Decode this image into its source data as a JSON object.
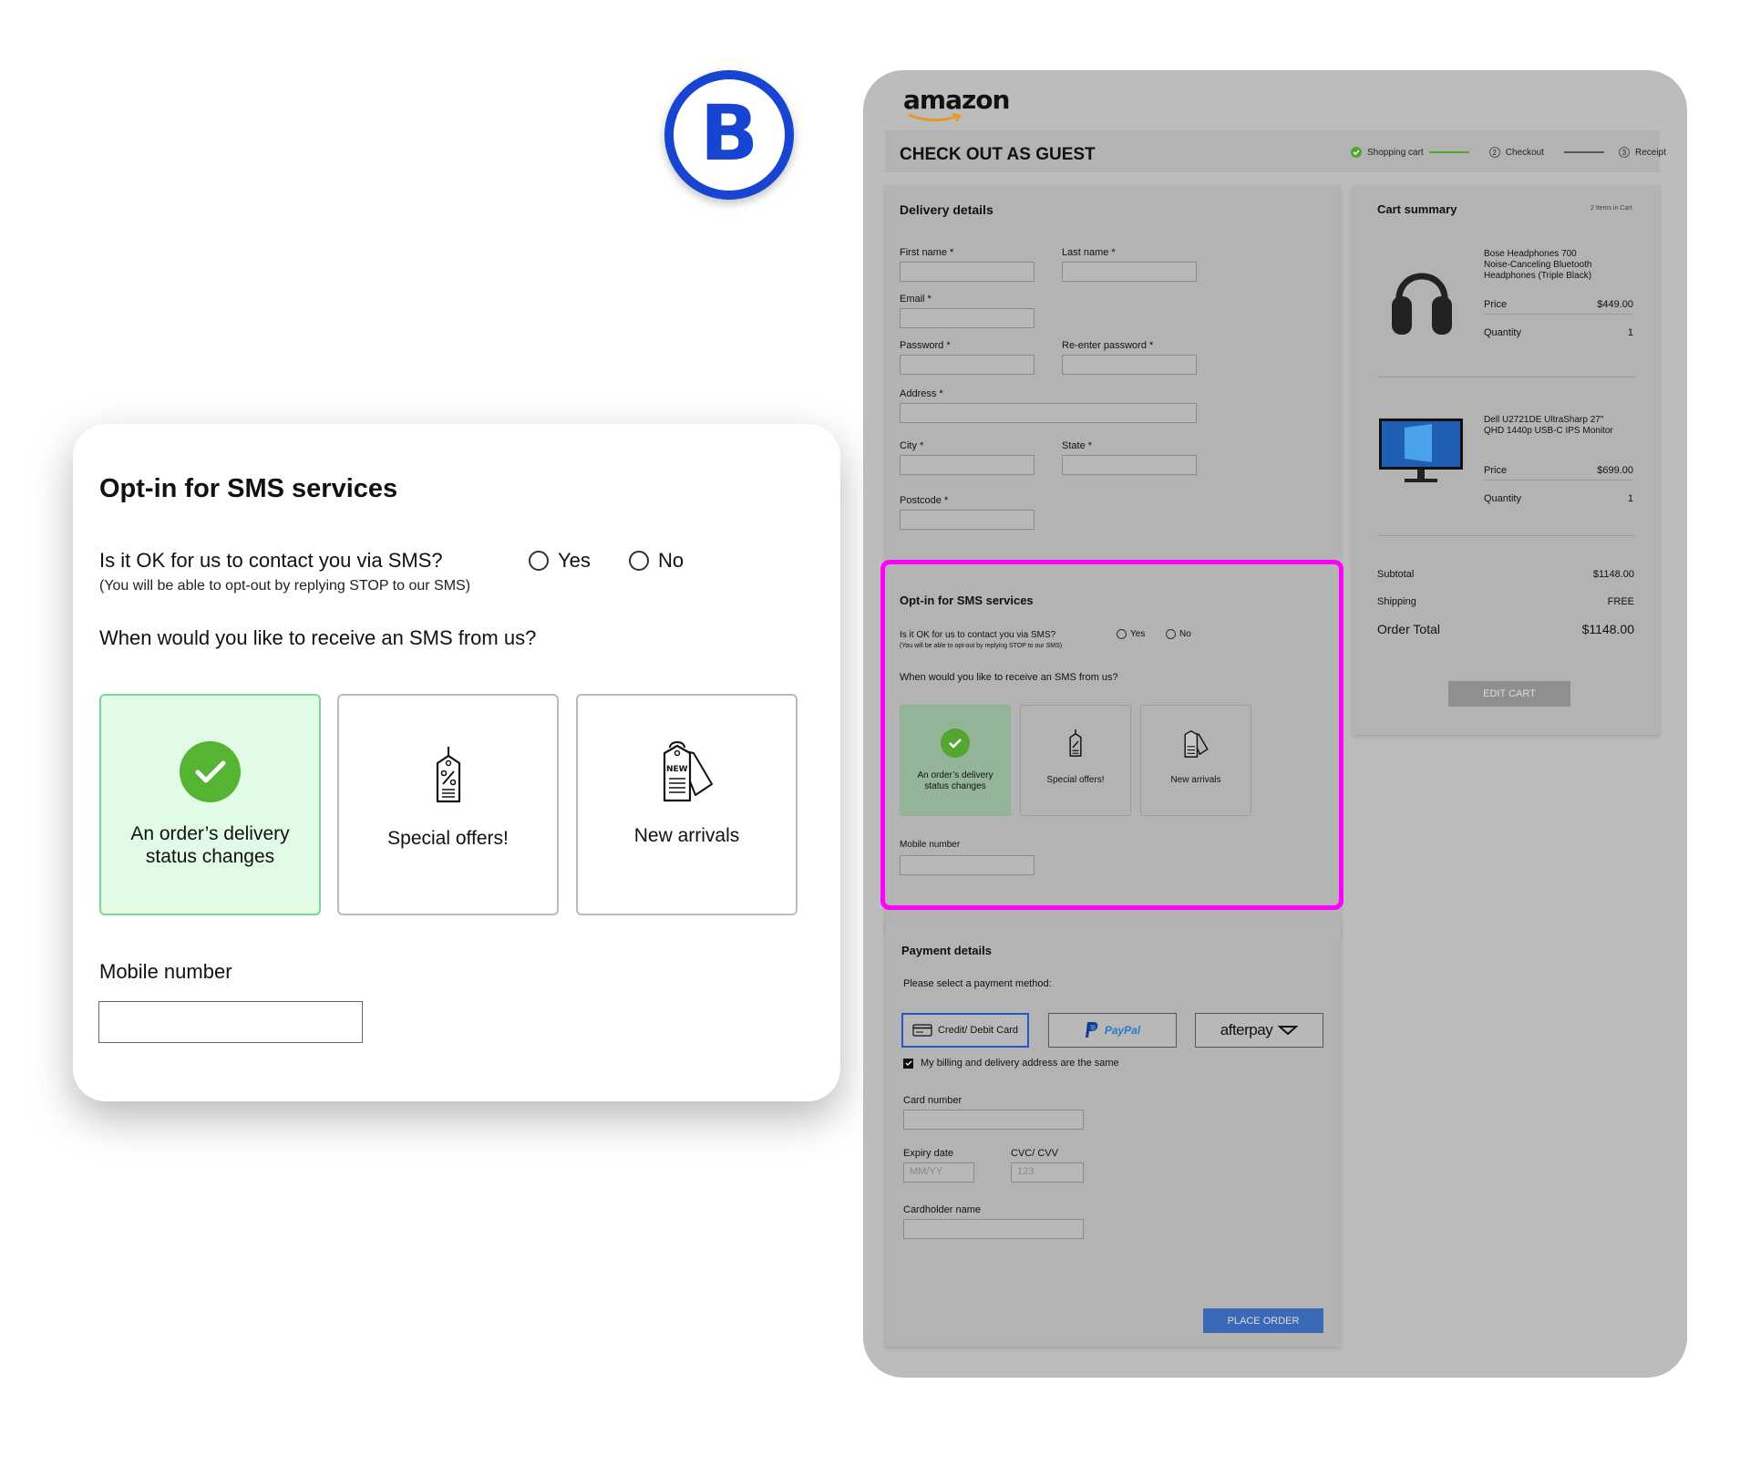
{
  "badge": {
    "letter": "B",
    "color": "#1744d1"
  },
  "zoom": {
    "title": "Opt-in for SMS services",
    "question": "Is it OK for us to contact you via SMS?",
    "question_note": "(You will be able to opt-out by replying STOP to our SMS)",
    "yes_label": "Yes",
    "no_label": "No",
    "when_label": "When would you like to receive an SMS from us?",
    "options": [
      {
        "line1": "An order’s delivery",
        "line2": "status changes",
        "selected": true,
        "icon": "check-icon"
      },
      {
        "line1": "Special offers!",
        "line2": "",
        "selected": false,
        "icon": "price-tag-icon"
      },
      {
        "line1": "New arrivals",
        "line2": "",
        "selected": false,
        "icon": "new-tag-icon"
      }
    ],
    "mobile_label": "Mobile number"
  },
  "panel": {
    "logo": "amazon",
    "header_title": "CHECK OUT AS GUEST",
    "steps": [
      {
        "num": "✓",
        "label": "Shopping cart",
        "done": true
      },
      {
        "num": "2",
        "label": "Checkout",
        "done": false
      },
      {
        "num": "3",
        "label": "Receipt",
        "done": false
      }
    ],
    "delivery": {
      "title": "Delivery details",
      "first_name": "First name *",
      "last_name": "Last name *",
      "email": "Email *",
      "password": "Password *",
      "reenter": "Re-enter password *",
      "address": "Address *",
      "city": "City *",
      "state": "State *",
      "postcode": "Postcode *"
    },
    "sms": {
      "title": "Opt-in for SMS services",
      "question": "Is it OK for us to contact you via SMS?",
      "note": "(You will be able to opt-out by replying STOP to our SMS)",
      "yes": "Yes",
      "no": "No",
      "when": "When would you like to receive an SMS from us?",
      "opt1a": "An order’s delivery",
      "opt1b": "status changes",
      "opt2": "Special offers!",
      "opt3": "New arrivals",
      "mobile": "Mobile number"
    },
    "payment": {
      "title": "Payment details",
      "select": "Please select a payment method:",
      "card_btn": "Credit/ Debit Card",
      "paypal_btn": "PayPal",
      "afterpay_btn": "afterpay",
      "same_address": "My billing and delivery address are the same",
      "card_number": "Card number",
      "expiry": "Expiry date",
      "cvc": "CVC/ CVV",
      "expiry_ph": "MM/YY",
      "cvc_ph": "123",
      "holder": "Cardholder name",
      "place_order": "PLACE ORDER"
    },
    "cart": {
      "title": "Cart summary",
      "count": "2 Items in Cart",
      "items": [
        {
          "name1": "Bose Headphones 700",
          "name2": "Noise-Canceling Bluetooth",
          "name3": "Headphones (Triple Black)",
          "price_label": "Price",
          "price": "$449.00",
          "qty_label": "Quantity",
          "qty": "1"
        },
        {
          "name1": "Dell U2721DE UltraSharp 27\"",
          "name2": "QHD 1440p USB-C IPS Monitor",
          "name3": "",
          "price_label": "Price",
          "price": "$699.00",
          "qty_label": "Quantity",
          "qty": "1"
        }
      ],
      "subtotal_label": "Subtotal",
      "subtotal": "$1148.00",
      "shipping_label": "Shipping",
      "shipping": "FREE",
      "total_label": "Order Total",
      "total": "$1148.00",
      "edit_btn": "EDIT CART"
    }
  },
  "colors": {
    "accent_green": "#55b431",
    "highlight": "#ff00ff",
    "place_order": "#3c69b5",
    "panel_bg": "#bcbcbc"
  }
}
